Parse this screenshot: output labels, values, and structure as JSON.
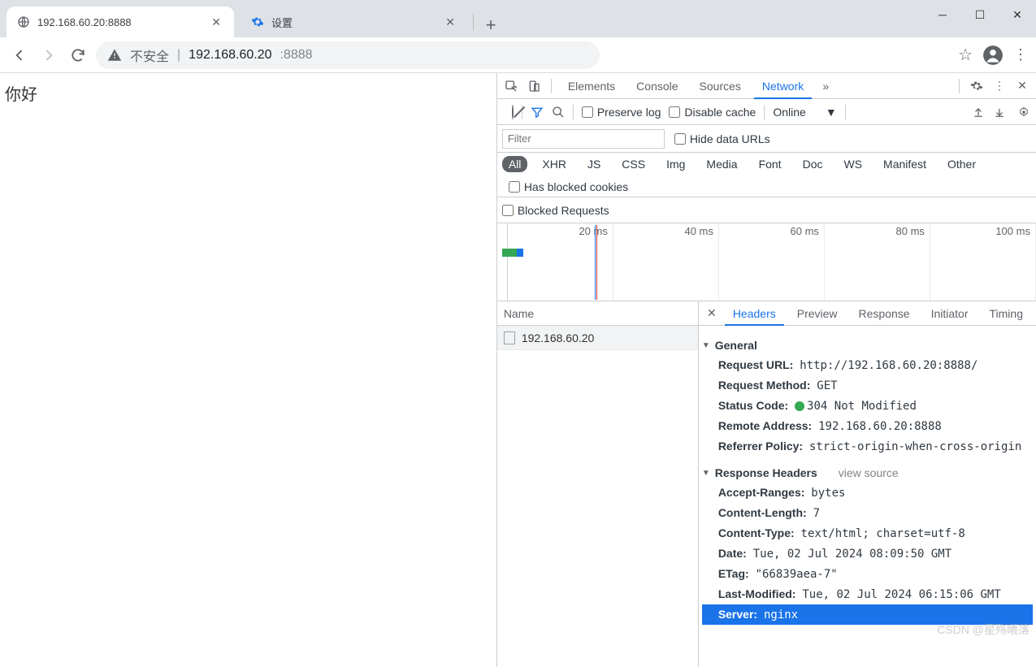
{
  "window": {
    "tabs": [
      {
        "title": "192.168.60.20:8888"
      },
      {
        "title": "设置"
      }
    ]
  },
  "addr": {
    "insecure": "不安全",
    "host": "192.168.60.20",
    "port": ":8888"
  },
  "page": {
    "body": "你好"
  },
  "devtools": {
    "panels": [
      "Elements",
      "Console",
      "Sources",
      "Network"
    ],
    "active": "Network",
    "toolbar": {
      "preserve": "Preserve log",
      "disablecache": "Disable cache",
      "throttle": "Online"
    },
    "filter": {
      "placeholder": "Filter",
      "hideurls": "Hide data URLs",
      "types": [
        "All",
        "XHR",
        "JS",
        "CSS",
        "Img",
        "Media",
        "Font",
        "Doc",
        "WS",
        "Manifest",
        "Other"
      ],
      "blockedcookies": "Has blocked cookies",
      "blockedreq": "Blocked Requests"
    },
    "timeline": [
      "20 ms",
      "40 ms",
      "60 ms",
      "80 ms",
      "100 ms"
    ],
    "reqlist": {
      "header": "Name",
      "rows": [
        "192.168.60.20"
      ]
    },
    "detail": {
      "tabs": [
        "Headers",
        "Preview",
        "Response",
        "Initiator",
        "Timing"
      ],
      "general": {
        "title": "General",
        "items": [
          {
            "k": "Request URL:",
            "v": "http://192.168.60.20:8888/"
          },
          {
            "k": "Request Method:",
            "v": "GET"
          },
          {
            "k": "Status Code:",
            "v": "304 Not Modified",
            "dot": true
          },
          {
            "k": "Remote Address:",
            "v": "192.168.60.20:8888"
          },
          {
            "k": "Referrer Policy:",
            "v": "strict-origin-when-cross-origin"
          }
        ]
      },
      "resp": {
        "title": "Response Headers",
        "viewsource": "view source",
        "items": [
          {
            "k": "Accept-Ranges:",
            "v": "bytes"
          },
          {
            "k": "Content-Length:",
            "v": "7"
          },
          {
            "k": "Content-Type:",
            "v": "text/html; charset=utf-8"
          },
          {
            "k": "Date:",
            "v": "Tue, 02 Jul 2024 08:09:50 GMT"
          },
          {
            "k": "ETag:",
            "v": "\"66839aea-7\""
          },
          {
            "k": "Last-Modified:",
            "v": "Tue, 02 Jul 2024 06:15:06 GMT"
          },
          {
            "k": "Server:",
            "v": "nginx",
            "hl": true
          }
        ]
      }
    }
  },
  "watermark": "CSDN @星殇曦落"
}
